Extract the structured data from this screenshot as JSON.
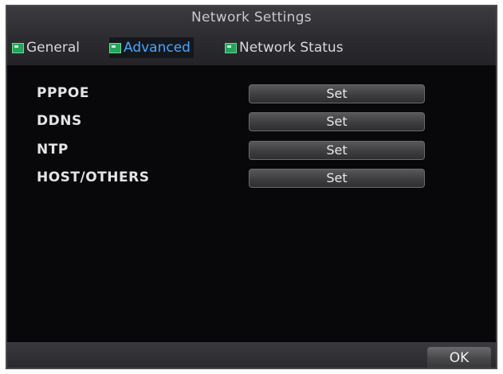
{
  "window": {
    "title": "Network Settings"
  },
  "tabs": [
    {
      "label": "General",
      "icon": "network-tab-icon",
      "active": false
    },
    {
      "label": "Advanced",
      "icon": "network-tab-icon",
      "active": true
    },
    {
      "label": "Network Status",
      "icon": "network-tab-icon",
      "active": false
    }
  ],
  "settings": [
    {
      "label": "PPPOE",
      "button": "Set"
    },
    {
      "label": "DDNS",
      "button": "Set"
    },
    {
      "label": "NTP",
      "button": "Set"
    },
    {
      "label": "HOST/OTHERS",
      "button": "Set"
    }
  ],
  "footer": {
    "ok_label": "OK"
  },
  "colors": {
    "background": "#08080b",
    "active_tab_text": "#4aa6ff",
    "tab_icon": "#27a45c"
  }
}
